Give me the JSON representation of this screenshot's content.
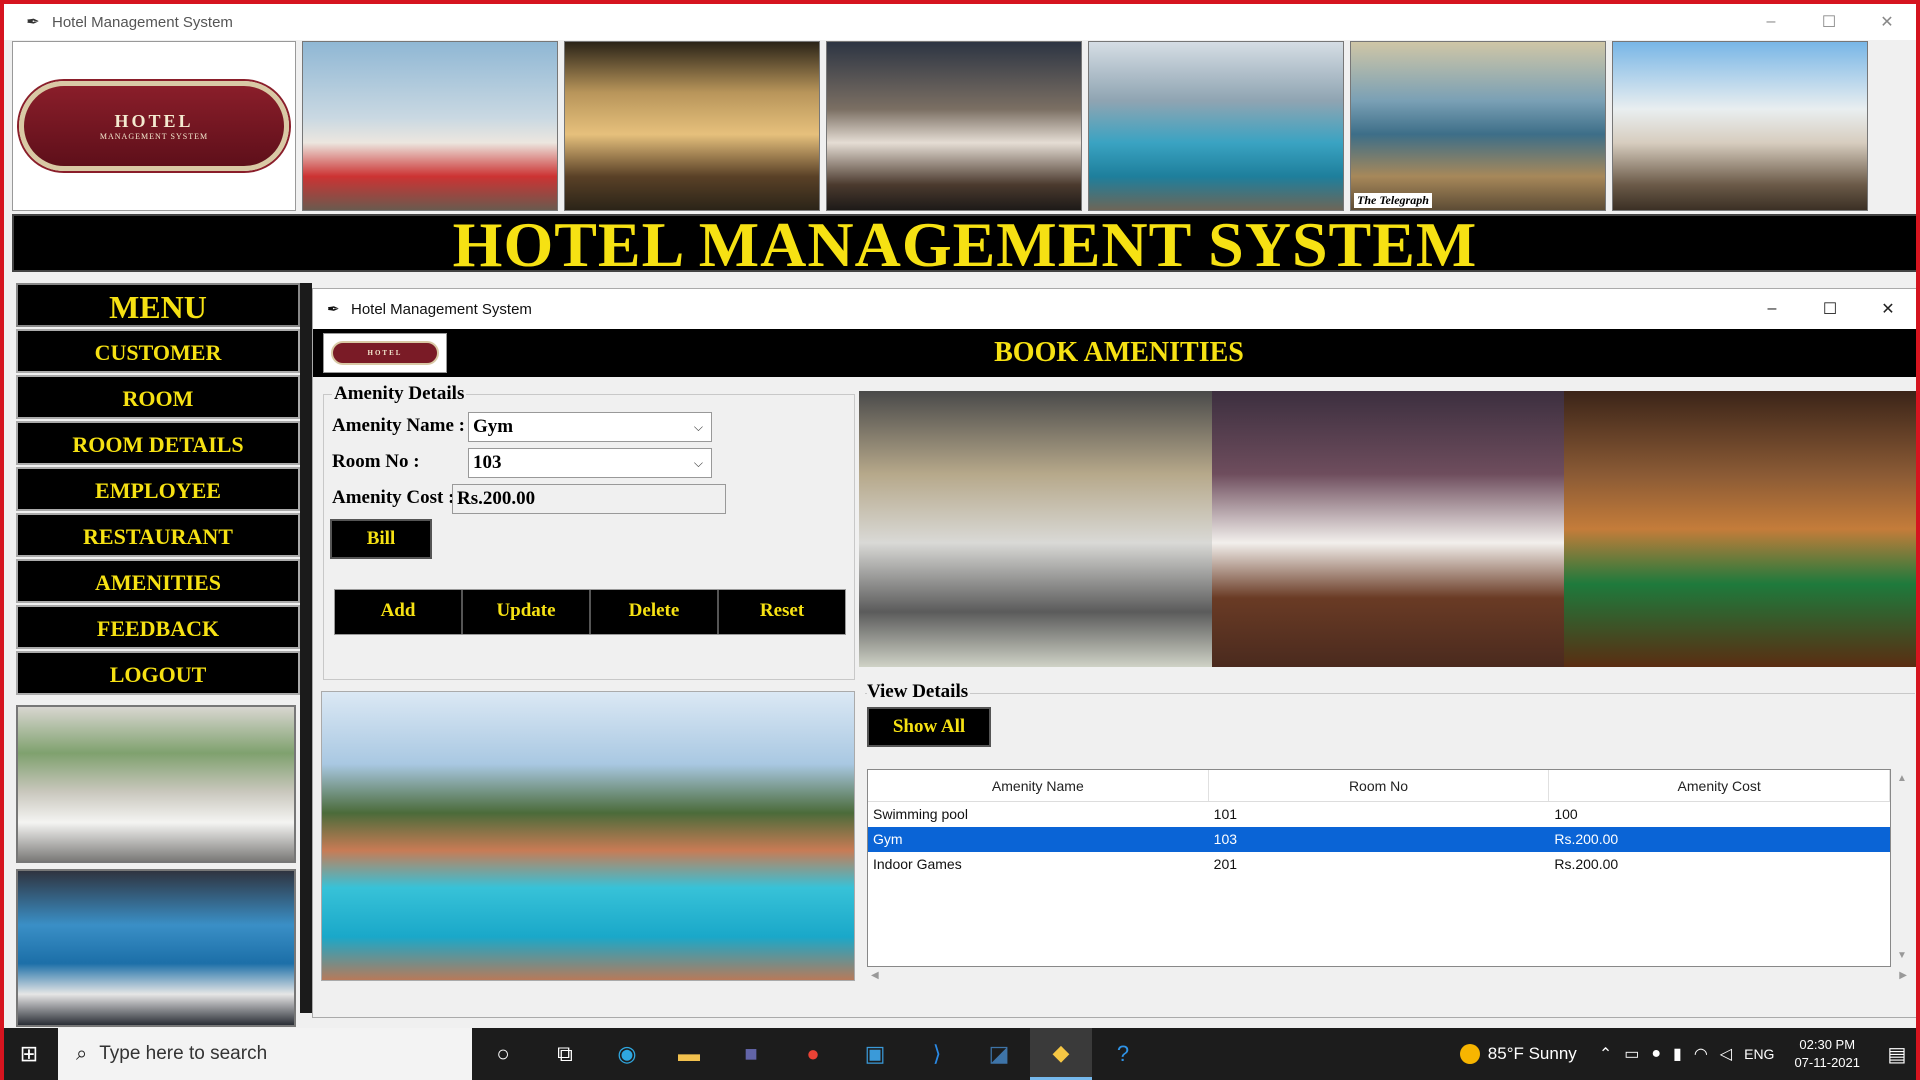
{
  "window": {
    "title": "Hotel Management System",
    "controls": [
      "–",
      "☐",
      "✕"
    ]
  },
  "logo": {
    "line1": "HOTEL",
    "line2": "MANAGEMENT SYSTEM"
  },
  "photo_caption": "The Telegraph",
  "headline": "HOTEL MANAGEMENT SYSTEM",
  "menu": {
    "title": "MENU",
    "items": [
      "CUSTOMER",
      "ROOM",
      "ROOM DETAILS",
      "EMPLOYEE",
      "RESTAURANT",
      "AMENITIES",
      "FEEDBACK",
      "LOGOUT"
    ]
  },
  "inner_window": {
    "title": "Hotel Management System",
    "logo_text": "HOTEL",
    "heading": "BOOK AMENITIES"
  },
  "form": {
    "group_title": "Amenity Details",
    "amenity_name_label": "Amenity Name :",
    "amenity_name_value": "Gym",
    "room_no_label": "Room No :",
    "room_no_value": "103",
    "amenity_cost_label": "Amenity Cost :",
    "amenity_cost_value": "Rs.200.00",
    "bill_label": "Bill",
    "add_label": "Add",
    "update_label": "Update",
    "delete_label": "Delete",
    "reset_label": "Reset"
  },
  "view": {
    "title": "View Details",
    "show_all_label": "Show All",
    "columns": [
      "Amenity Name",
      "Room No",
      "Amenity Cost"
    ],
    "rows": [
      [
        "Swimming pool",
        "101",
        "100"
      ],
      [
        "Gym",
        "103",
        "Rs.200.00"
      ],
      [
        "Indoor Games",
        "201",
        "Rs.200.00"
      ]
    ],
    "selected_row": 1
  },
  "taskbar": {
    "search_placeholder": "Type here to search",
    "weather": "85°F  Sunny",
    "lang": "ENG",
    "time": "02:30 PM",
    "date": "07-11-2021"
  },
  "colors": {
    "accent_yellow": "#f6e113",
    "bar_black": "#000000",
    "selection_blue": "#0a64d6",
    "frame_red": "#d6141f"
  }
}
